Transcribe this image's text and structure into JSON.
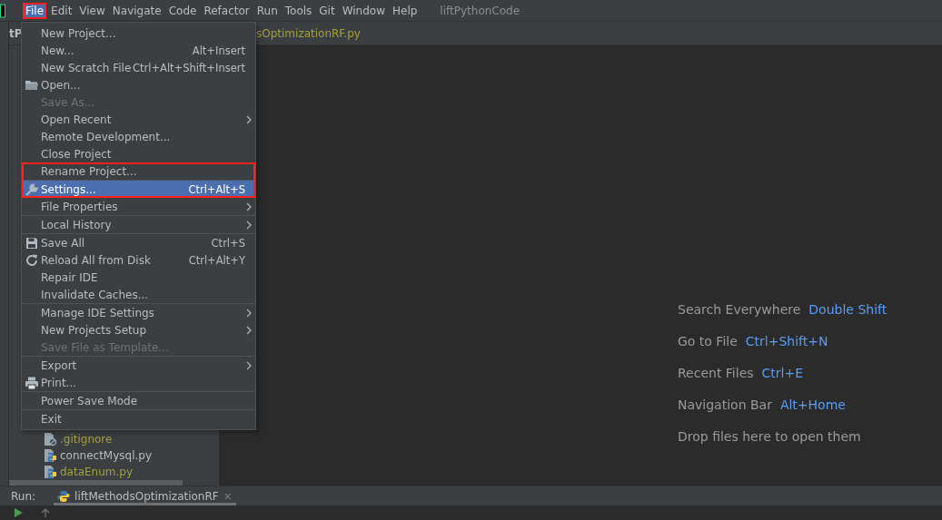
{
  "window": {
    "title": "liftPythonCode"
  },
  "menu_bar": [
    {
      "label": "File",
      "selected": true,
      "outlined": true
    },
    {
      "label": "Edit",
      "selected": false,
      "outlined": false
    },
    {
      "label": "View",
      "selected": false,
      "outlined": false
    },
    {
      "label": "Navigate",
      "selected": false,
      "outlined": false
    },
    {
      "label": "Code",
      "selected": false,
      "outlined": false
    },
    {
      "label": "Refactor",
      "selected": false,
      "outlined": false
    },
    {
      "label": "Run",
      "selected": false,
      "outlined": false
    },
    {
      "label": "Tools",
      "selected": false,
      "outlined": false
    },
    {
      "label": "Git",
      "selected": false,
      "outlined": false
    },
    {
      "label": "Window",
      "selected": false,
      "outlined": false
    },
    {
      "label": "Help",
      "selected": false,
      "outlined": false
    }
  ],
  "project_panel": {
    "header": "tP",
    "tree": [
      {
        "label": ".gitignore",
        "kind": "ignore",
        "color": "#a39f3b"
      },
      {
        "label": "connectMysql.py",
        "kind": "python",
        "color": "#bbbbbb"
      },
      {
        "label": "dataEnum.py",
        "kind": "python",
        "color": "#a39f3b"
      }
    ]
  },
  "editor": {
    "tab": "sOptimizationRF.py",
    "hints": [
      {
        "label": "Search Everywhere",
        "shortcut": "Double Shift"
      },
      {
        "label": "Go to File",
        "shortcut": "Ctrl+Shift+N"
      },
      {
        "label": "Recent Files",
        "shortcut": "Ctrl+E"
      },
      {
        "label": "Navigation Bar",
        "shortcut": "Alt+Home"
      },
      {
        "label": "Drop files here to open them"
      }
    ]
  },
  "file_menu": {
    "groups": [
      [
        {
          "label": "New Project...",
          "submenu": false,
          "disabled": false,
          "selected": false,
          "outlined": false
        },
        {
          "label": "New...",
          "shortcut": "Alt+Insert",
          "submenu": false,
          "disabled": false,
          "selected": false,
          "outlined": false
        },
        {
          "label": "New Scratch File",
          "shortcut": "Ctrl+Alt+Shift+Insert",
          "submenu": false,
          "disabled": false,
          "selected": false,
          "outlined": false
        },
        {
          "label": "Open...",
          "kind": "folder",
          "submenu": false,
          "disabled": false,
          "selected": false,
          "outlined": false
        },
        {
          "label": "Save As...",
          "submenu": false,
          "disabled": true,
          "selected": false,
          "outlined": false
        },
        {
          "label": "Open Recent",
          "submenu": true,
          "disabled": false,
          "selected": false,
          "outlined": false
        },
        {
          "label": "Remote Development...",
          "submenu": false,
          "disabled": false,
          "selected": false,
          "outlined": false
        },
        {
          "label": "Close Project",
          "submenu": false,
          "disabled": false,
          "selected": false,
          "outlined": false
        },
        {
          "label": "Rename Project...",
          "submenu": false,
          "disabled": false,
          "selected": false,
          "outlined": true
        }
      ],
      [
        {
          "label": "Settings...",
          "kind": "wrench",
          "shortcut": "Ctrl+Alt+S",
          "submenu": false,
          "disabled": false,
          "selected": true,
          "outlined": true
        },
        {
          "label": "File Properties",
          "submenu": true,
          "disabled": false,
          "selected": false,
          "outlined": false
        }
      ],
      [
        {
          "label": "Local History",
          "submenu": true,
          "disabled": false,
          "selected": false,
          "outlined": false
        }
      ],
      [
        {
          "label": "Save All",
          "kind": "save",
          "shortcut": "Ctrl+S",
          "submenu": false,
          "disabled": false,
          "selected": false,
          "outlined": false
        },
        {
          "label": "Reload All from Disk",
          "kind": "reload",
          "shortcut": "Ctrl+Alt+Y",
          "submenu": false,
          "disabled": false,
          "selected": false,
          "outlined": false
        },
        {
          "label": "Repair IDE",
          "submenu": false,
          "disabled": false,
          "selected": false,
          "outlined": false
        },
        {
          "label": "Invalidate Caches...",
          "submenu": false,
          "disabled": false,
          "selected": false,
          "outlined": false
        }
      ],
      [
        {
          "label": "Manage IDE Settings",
          "submenu": true,
          "disabled": false,
          "selected": false,
          "outlined": false
        },
        {
          "label": "New Projects Setup",
          "submenu": true,
          "disabled": false,
          "selected": false,
          "outlined": false
        },
        {
          "label": "Save File as Template...",
          "submenu": false,
          "disabled": true,
          "selected": false,
          "outlined": false
        }
      ],
      [
        {
          "label": "Export",
          "submenu": true,
          "disabled": false,
          "selected": false,
          "outlined": false
        },
        {
          "label": "Print...",
          "kind": "print",
          "submenu": false,
          "disabled": false,
          "selected": false,
          "outlined": false
        }
      ],
      [
        {
          "label": "Power Save Mode",
          "submenu": false,
          "disabled": false,
          "selected": false,
          "outlined": false
        }
      ],
      [
        {
          "label": "Exit",
          "submenu": false,
          "disabled": false,
          "selected": false,
          "outlined": false
        }
      ]
    ]
  },
  "run_panel": {
    "label": "Run:",
    "tabs": [
      {
        "label": "liftMethodsOptimizationRF",
        "close": "×",
        "selected": true
      }
    ]
  }
}
